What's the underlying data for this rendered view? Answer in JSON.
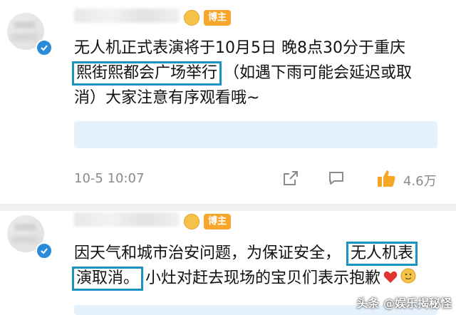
{
  "posts": [
    {
      "badge": "博主",
      "lines": [
        {
          "parts": [
            {
              "text": "无人机正式表演将于10月5日 晚8点30分于重庆",
              "hl": false
            }
          ]
        },
        {
          "parts": [
            {
              "text": "熙街熙都会广场举行",
              "hl": true
            },
            {
              "text": "（如遇下雨可能会延迟或取",
              "hl": false
            }
          ]
        },
        {
          "parts": [
            {
              "text": "消）大家注意有序观看哦~",
              "hl": false
            }
          ]
        }
      ],
      "time": "10-5 10:07",
      "like_count": "4.6万"
    },
    {
      "badge": "博主",
      "lines": [
        {
          "parts": [
            {
              "text": "因天气和城市治安问题，为保证安全，",
              "hl": false
            },
            {
              "text": "无人机表",
              "hl": true
            }
          ]
        },
        {
          "parts": [
            {
              "text": "演取消。",
              "hl": true
            },
            {
              "text": "小灶对赶去现场的宝贝们表示抱歉",
              "hl": false
            }
          ]
        }
      ]
    }
  ],
  "watermark": "头条 @娱乐揭秘怪",
  "colors": {
    "highlight_border": "#1a94c4",
    "badge": "#f6a62a",
    "verified": "#2b8bd8",
    "like": "#f5a623",
    "heart": "#e2332f"
  },
  "icons": [
    "verified-icon",
    "share-icon",
    "comment-icon",
    "like-icon",
    "heart-emoji-icon",
    "hug-emoji-icon"
  ]
}
